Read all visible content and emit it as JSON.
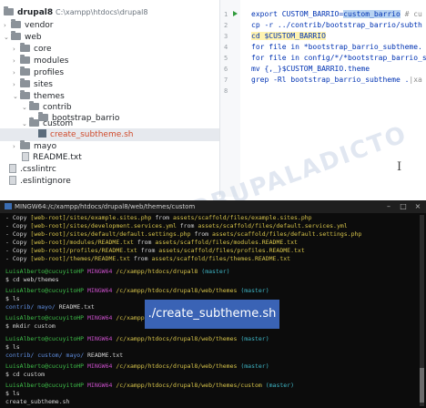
{
  "project": {
    "name": "drupal8",
    "path": "C:\\xampp\\htdocs\\drupal8"
  },
  "tree": [
    {
      "label": "vendor",
      "type": "folder",
      "arrow": "›"
    },
    {
      "label": "web",
      "type": "folder",
      "arrow": "⌄"
    },
    {
      "label": "core",
      "type": "folder",
      "arrow": "›"
    },
    {
      "label": "modules",
      "type": "folder",
      "arrow": "›"
    },
    {
      "label": "profiles",
      "type": "folder",
      "arrow": "›"
    },
    {
      "label": "sites",
      "type": "folder",
      "arrow": "›"
    },
    {
      "label": "themes",
      "type": "folder",
      "arrow": "⌄"
    },
    {
      "label": "contrib",
      "type": "folder",
      "arrow": "⌄"
    },
    {
      "label": "bootstrap_barrio",
      "type": "folder",
      "arrow": "›"
    },
    {
      "label": "custom",
      "type": "folder",
      "arrow": "⌄"
    },
    {
      "label": "create_subtheme.sh",
      "type": "sh",
      "arrow": ""
    },
    {
      "label": "mayo",
      "type": "folder",
      "arrow": "›"
    },
    {
      "label": "README.txt",
      "type": "file",
      "arrow": ""
    },
    {
      "label": ".csslintrc",
      "type": "file",
      "arrow": ""
    },
    {
      "label": ".eslintignore",
      "type": "file",
      "arrow": ""
    }
  ],
  "gutter": [
    "1",
    "2",
    "3",
    "4",
    "5",
    "6",
    "7",
    "8"
  ],
  "code": {
    "line1_a": "export CUSTOM_BARRIO=",
    "line1_sel": "custom_barrio",
    "line1_cm": " # cu",
    "line2": "cp -r ../contrib/bootstrap_barrio/subth",
    "line3": "cd $CUSTOM_BARRIO",
    "line4": "for file in *bootstrap_barrio_subtheme.",
    "line5": "for file in config/*/*bootstrap_barrio_s",
    "line6": "mv {,_}$CUSTOM_BARRIO.theme",
    "line7_a": "grep -Rl bootstrap_barrio_subtheme .",
    "line7_b": "|xa"
  },
  "cursor_glyph": "I",
  "watermark": "DRUPALADICTO",
  "terminal": {
    "title": "MINGW64:/c/xampp/htdocs/drupal8/web/themes/custom",
    "win_min": "–",
    "win_max": "□",
    "win_close": "×",
    "copy_lines": [
      {
        "dash": "- Copy ",
        "src": "[web-root]/sites/example.sites.php",
        "mid": " from ",
        "dst": "assets/scaffold/files/example.sites.php"
      },
      {
        "dash": "- Copy ",
        "src": "[web-root]/sites/development.services.yml",
        "mid": " from ",
        "dst": "assets/scaffold/files/default.services.yml"
      },
      {
        "dash": "- Copy ",
        "src": "[web-root]/sites/default/default.settings.php",
        "mid": " from ",
        "dst": "assets/scaffold/files/default.settings.php"
      },
      {
        "dash": "- Copy ",
        "src": "[web-root]/modules/README.txt",
        "mid": " from ",
        "dst": "assets/scaffold/files/modules.README.txt"
      },
      {
        "dash": "- Copy ",
        "src": "[web-root]/profiles/README.txt",
        "mid": " from ",
        "dst": "assets/scaffold/files/profiles.README.txt"
      },
      {
        "dash": "- Copy ",
        "src": "[web-root]/themes/README.txt",
        "mid": " from ",
        "dst": "assets/scaffold/files/themes.README.txt"
      }
    ],
    "user": "LuisAlberto@cucuyitoHP",
    "shell": "MINGW64",
    "branch": "(master)",
    "paths": {
      "p1": "/c/xampp/htdocs/drupal8",
      "p2": "/c/xampp/htdocs/drupal8/web/themes",
      "p3": "/c/xampp/htdocs/drupal8/web/themes/custom"
    },
    "cmds": {
      "c1": "$ cd web/themes",
      "c2": "$ ls",
      "c3": "$ mkdir custom",
      "c4": "$ ls",
      "c5": "$ cd custom",
      "c6": "$ ls"
    },
    "ls1": {
      "a": "contrib/",
      "b": "  mayo/",
      "c": "  README.txt"
    },
    "ls2": {
      "a": "contrib/",
      "b": "  custom/",
      "c": "  mayo/",
      "d": "  README.txt"
    },
    "ls3": "create_subtheme.sh"
  },
  "overlay_label": "./create_subtheme.sh"
}
